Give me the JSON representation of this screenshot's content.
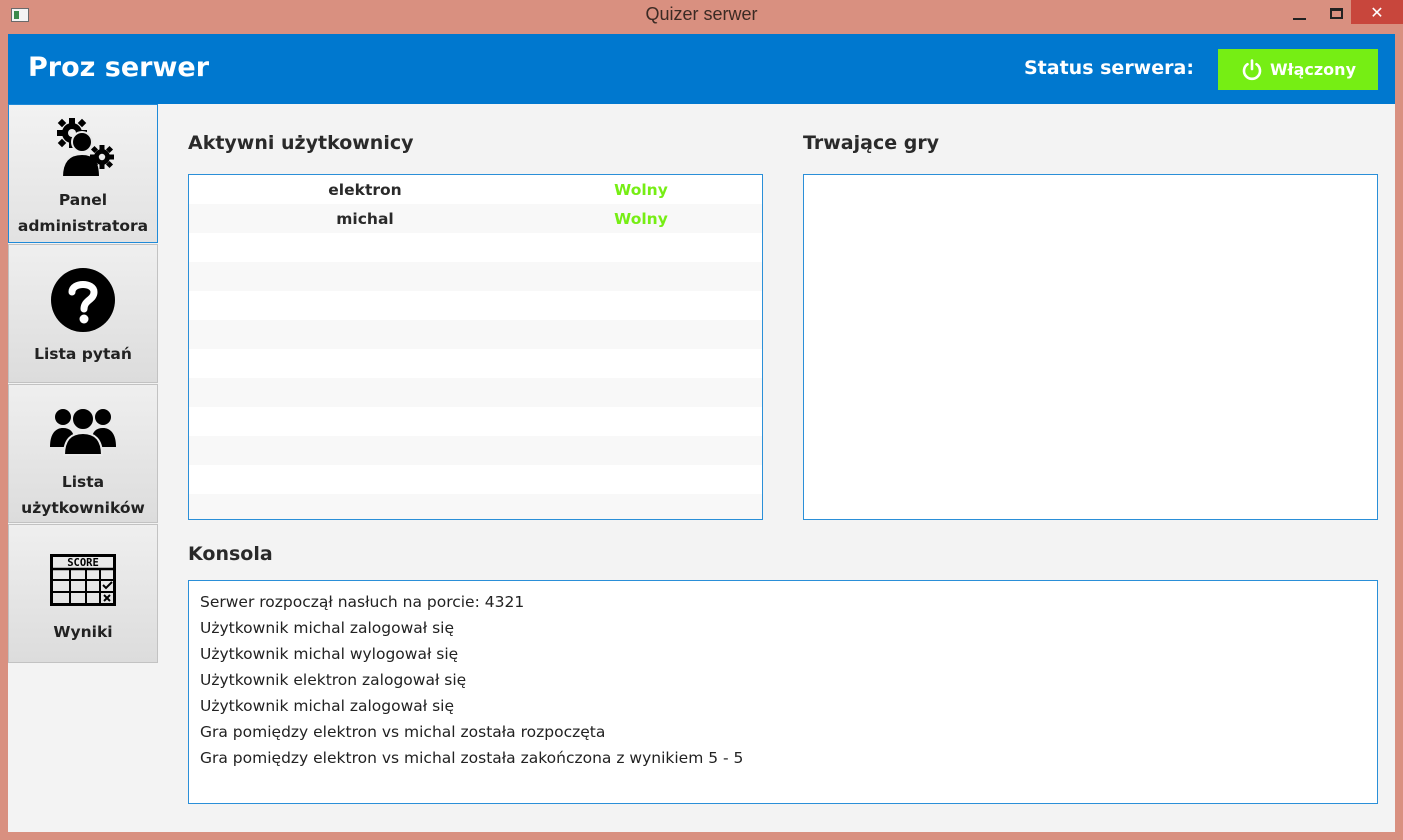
{
  "window": {
    "title": "Quizer serwer",
    "close_glyph": "✕"
  },
  "header": {
    "title": "Proz serwer",
    "status_label": "Status serwera:",
    "status_value": "Włączony",
    "status_icon": "power-icon",
    "status_color": "#76ee14",
    "brand_color": "#0078cf"
  },
  "sidebar": {
    "items": [
      {
        "label_line1": "Panel",
        "label_line2": "administratora",
        "icon": "admin-gears-icon",
        "active": true
      },
      {
        "label_line1": "Lista pytań",
        "label_line2": "",
        "icon": "question-icon",
        "active": false
      },
      {
        "label_line1": "Lista",
        "label_line2": "użytkowników",
        "icon": "users-icon",
        "active": false
      },
      {
        "label_line1": "Wyniki",
        "label_line2": "",
        "icon": "score-icon",
        "active": false
      }
    ]
  },
  "score_icon_text": "SCORE",
  "active_users": {
    "title": "Aktywni użytkownicy",
    "rows": [
      {
        "name": "elektron",
        "status": "Wolny"
      },
      {
        "name": "michal",
        "status": "Wolny"
      }
    ]
  },
  "games": {
    "title": "Trwające gry",
    "rows": []
  },
  "console": {
    "title": "Konsola",
    "lines": [
      "Serwer rozpoczął nasłuch na porcie: 4321",
      "Użytkownik michal zalogował się",
      "Użytkownik michal wylogował się",
      "Użytkownik elektron zalogował się",
      "Użytkownik michal zalogował się",
      "Gra pomiędzy elektron vs michal została rozpoczęta",
      "Gra pomiędzy elektron vs michal została zakończona z wynikiem 5 - 5"
    ]
  }
}
